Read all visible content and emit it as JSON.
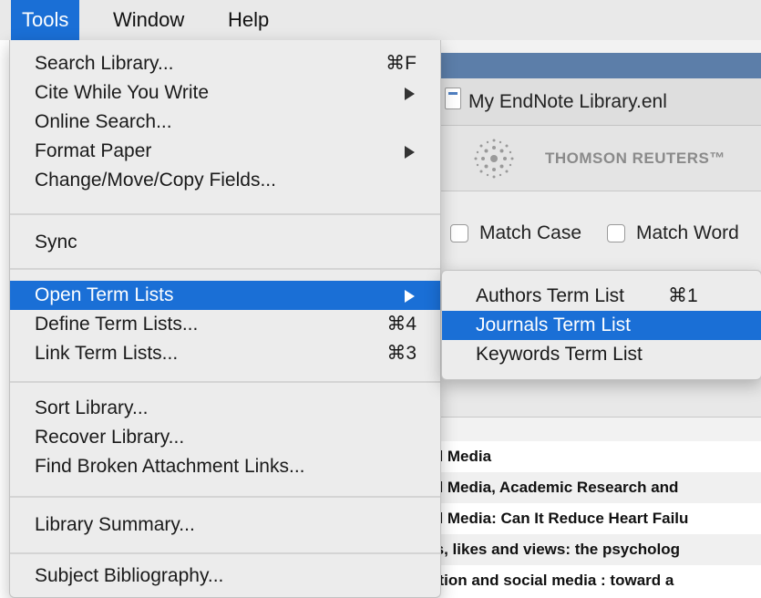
{
  "menubar": {
    "items": [
      {
        "label": "Tools",
        "active": true
      },
      {
        "label": "Window",
        "active": false
      },
      {
        "label": "Help",
        "active": false
      }
    ]
  },
  "window": {
    "document_name": "My EndNote Library.enl",
    "logo_text": "THOMSON REUTERS",
    "logo_tm": "™",
    "options": {
      "match_case": {
        "label": "Match Case",
        "checked": false
      },
      "match_words": {
        "label": "Match Word",
        "checked": false
      }
    },
    "rows": [
      "al Media",
      "al Media, Academic Research and",
      "al Media: Can It Reduce Heart Failu",
      "ts, likes and views: the psycholog",
      "ation and social media : toward a"
    ]
  },
  "tools_menu": {
    "items": [
      {
        "label": "Search Library...",
        "shortcut": "⌘F"
      },
      {
        "label": "Cite While You Write",
        "submenu": true
      },
      {
        "label": "Online Search..."
      },
      {
        "label": "Format Paper",
        "submenu": true
      },
      {
        "label": "Change/Move/Copy Fields..."
      },
      {
        "label": "Sync"
      },
      {
        "label": "Open Term Lists",
        "submenu": true,
        "highlighted": true
      },
      {
        "label": "Define Term Lists...",
        "shortcut": "⌘4"
      },
      {
        "label": "Link Term Lists...",
        "shortcut": "⌘3"
      },
      {
        "label": "Sort Library..."
      },
      {
        "label": "Recover Library..."
      },
      {
        "label": "Find Broken Attachment Links..."
      },
      {
        "label": "Library Summary..."
      },
      {
        "label": "Subject Bibliography..."
      }
    ]
  },
  "submenu": {
    "items": [
      {
        "label": "Authors Term List",
        "shortcut": "⌘1"
      },
      {
        "label": "Journals Term List",
        "highlighted": true
      },
      {
        "label": "Keywords Term List"
      }
    ]
  },
  "colors": {
    "highlight": "#1a6fd6",
    "menu_background": "#ececec",
    "menubar_background": "#e9e9e9"
  }
}
